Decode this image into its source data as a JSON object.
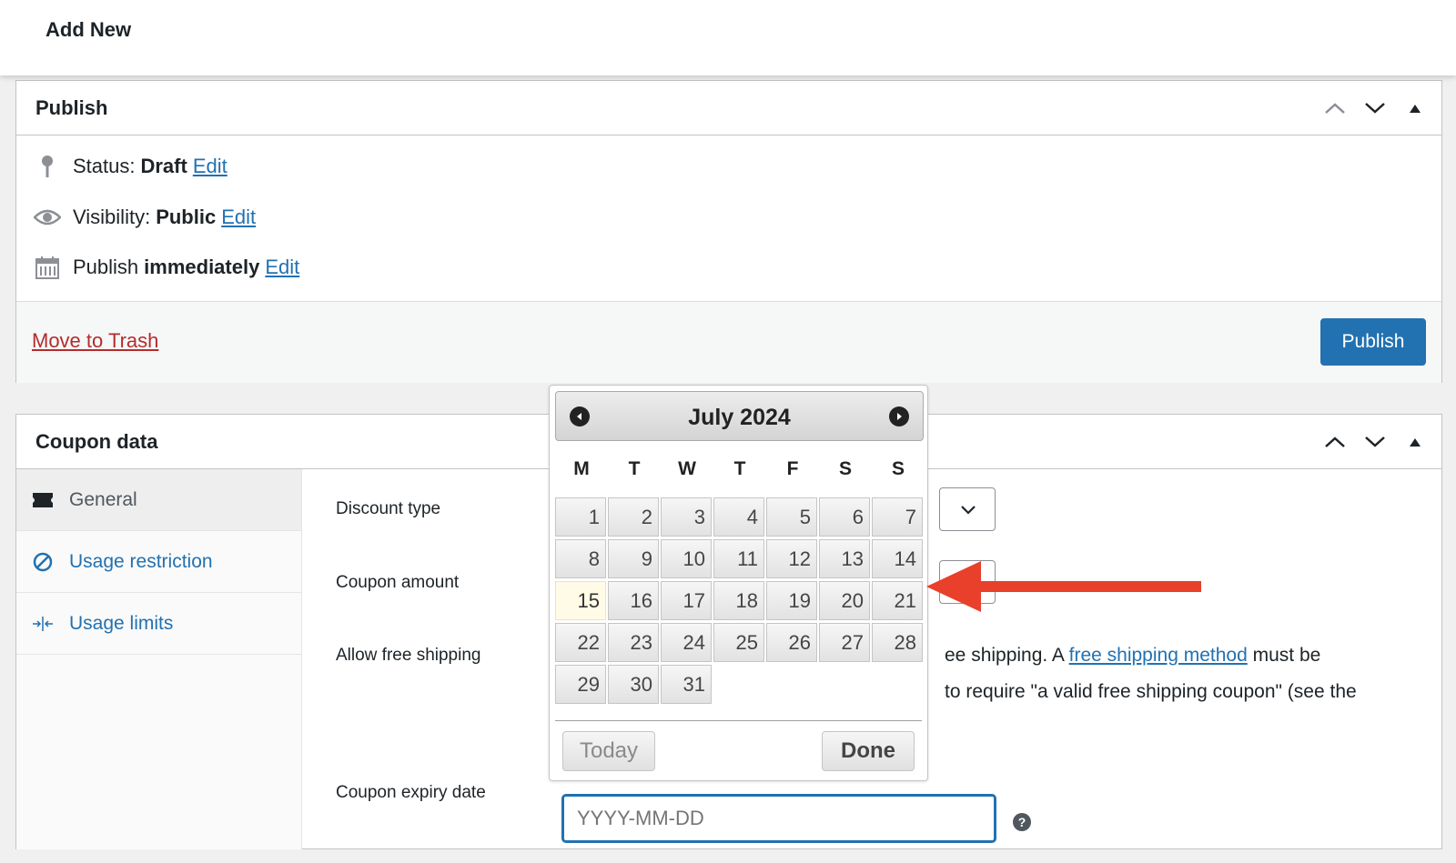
{
  "header": {
    "title": "Add New"
  },
  "publish": {
    "title": "Publish",
    "status_label": "Status:",
    "status_value": "Draft",
    "visibility_label": "Visibility:",
    "visibility_value": "Public",
    "schedule_label": "Publish",
    "schedule_value": "immediately",
    "edit_link": "Edit",
    "trash_link": "Move to Trash",
    "publish_button": "Publish"
  },
  "coupon": {
    "title": "Coupon data",
    "tabs": [
      {
        "label": "General",
        "icon": "ticket-icon",
        "active": true
      },
      {
        "label": "Usage restriction",
        "icon": "restriction-icon",
        "active": false
      },
      {
        "label": "Usage limits",
        "icon": "limits-icon",
        "active": false
      }
    ],
    "fields": {
      "discount_type": "Discount type",
      "coupon_amount": "Coupon amount",
      "free_shipping": "Allow free shipping",
      "expiry_date": "Coupon expiry date"
    },
    "free_shipping_desc_pre": "ee shipping. A ",
    "free_shipping_link": "free shipping method",
    "free_shipping_desc_post": " must be",
    "free_shipping_desc_line2": "to require \"a valid free shipping coupon\" (see the",
    "expiry_placeholder": "YYYY-MM-DD",
    "help_icon": "?"
  },
  "datepicker": {
    "month_year": "July 2024",
    "weekdays": [
      "M",
      "T",
      "W",
      "T",
      "F",
      "S",
      "S"
    ],
    "days": [
      "1",
      "2",
      "3",
      "4",
      "5",
      "6",
      "7",
      "8",
      "9",
      "10",
      "11",
      "12",
      "13",
      "14",
      "15",
      "16",
      "17",
      "18",
      "19",
      "20",
      "21",
      "22",
      "23",
      "24",
      "25",
      "26",
      "27",
      "28",
      "29",
      "30",
      "31"
    ],
    "highlighted_day": "15",
    "today_button": "Today",
    "done_button": "Done"
  },
  "colors": {
    "accent": "#2271b1",
    "trash": "#b32d2e",
    "arrow": "#e8402a"
  }
}
